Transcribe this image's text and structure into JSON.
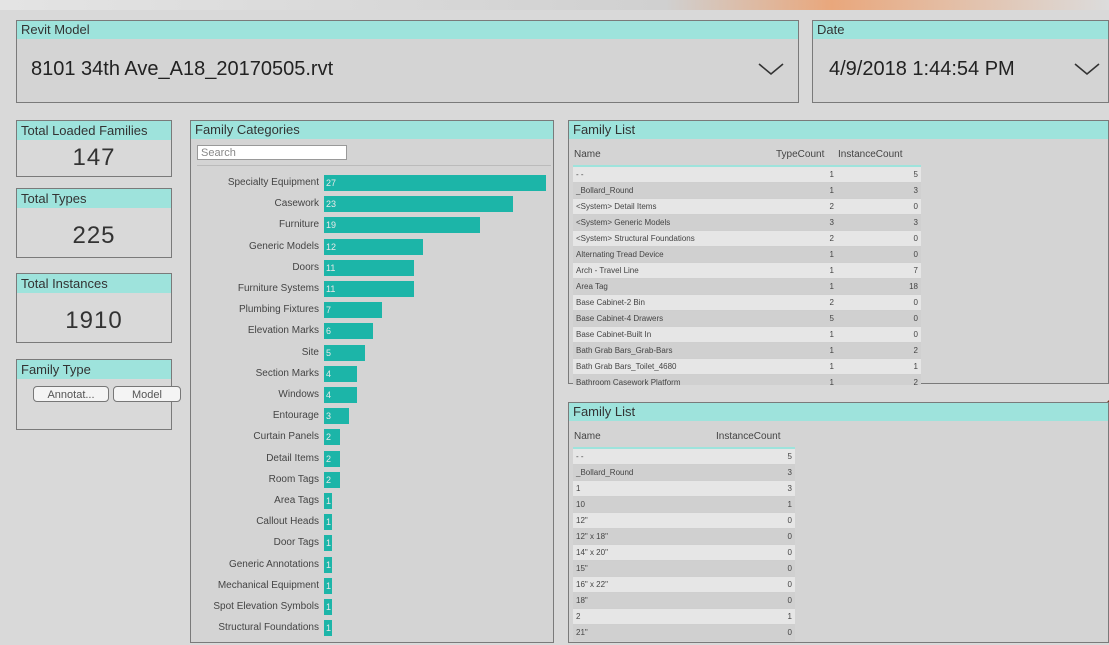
{
  "revit_model": {
    "label": "Revit Model",
    "value": "8101 34th Ave_A18_20170505.rvt"
  },
  "date": {
    "label": "Date",
    "value": "4/9/2018 1:44:54 PM"
  },
  "cards": {
    "loaded_families": {
      "label": "Total Loaded Families",
      "value": "147"
    },
    "types": {
      "label": "Total Types",
      "value": "225"
    },
    "instances": {
      "label": "Total Instances",
      "value": "1910"
    }
  },
  "family_type": {
    "label": "Family Type",
    "buttons": [
      "Annotat...",
      "Model"
    ]
  },
  "family_categories": {
    "title": "Family Categories",
    "search_placeholder": "Search"
  },
  "chart_data": {
    "type": "bar",
    "orientation": "horizontal",
    "categories": [
      "Specialty Equipment",
      "Casework",
      "Furniture",
      "Generic Models",
      "Doors",
      "Furniture Systems",
      "Plumbing Fixtures",
      "Elevation Marks",
      "Site",
      "Section Marks",
      "Windows",
      "Entourage",
      "Curtain Panels",
      "Detail Items",
      "Room Tags",
      "Area Tags",
      "Callout Heads",
      "Door Tags",
      "Generic Annotations",
      "Mechanical Equipment",
      "Spot Elevation Symbols",
      "Structural Foundations"
    ],
    "values": [
      27,
      23,
      19,
      12,
      11,
      11,
      7,
      6,
      5,
      4,
      4,
      3,
      2,
      2,
      2,
      1,
      1,
      1,
      1,
      1,
      1,
      1
    ],
    "labels": [
      "27",
      "23",
      "19",
      "12",
      "11",
      "11",
      "7",
      "6",
      "5",
      "4",
      "4",
      "3",
      "2",
      "2",
      "2",
      "1",
      "1",
      "1",
      "1",
      "1",
      "1",
      "1"
    ]
  },
  "family_list_1": {
    "title": "Family List",
    "headers": [
      "Name",
      "TypeCount",
      "InstanceCount"
    ],
    "rows": [
      [
        "- -",
        "1",
        "5"
      ],
      [
        "_Bollard_Round",
        "1",
        "3"
      ],
      [
        "<System> Detail Items",
        "2",
        "0"
      ],
      [
        "<System> Generic Models",
        "3",
        "3"
      ],
      [
        "<System> Structural Foundations",
        "2",
        "0"
      ],
      [
        "Alternating Tread Device",
        "1",
        "0"
      ],
      [
        "Arch - Travel Line",
        "1",
        "7"
      ],
      [
        "Area Tag",
        "1",
        "18"
      ],
      [
        "Base Cabinet-2 Bin",
        "2",
        "0"
      ],
      [
        "Base Cabinet-4 Drawers",
        "5",
        "0"
      ],
      [
        "Base Cabinet-Built In",
        "1",
        "0"
      ],
      [
        "Bath Grab Bars_Grab-Bars",
        "1",
        "2"
      ],
      [
        "Bath Grab Bars_Toilet_4680",
        "1",
        "1"
      ],
      [
        "Bathroom Casework Platform",
        "1",
        "2"
      ]
    ]
  },
  "family_list_2": {
    "title": "Family List",
    "headers": [
      "Name",
      "InstanceCount"
    ],
    "rows": [
      [
        "- -",
        "5"
      ],
      [
        "_Bollard_Round",
        "3"
      ],
      [
        "1",
        "3"
      ],
      [
        "10",
        "1"
      ],
      [
        "12\"",
        "0"
      ],
      [
        "12\" x 18\"",
        "0"
      ],
      [
        "14\" x 20\"",
        "0"
      ],
      [
        "15\"",
        "0"
      ],
      [
        "16\" x 22\"",
        "0"
      ],
      [
        "18\"",
        "0"
      ],
      [
        "2",
        "1"
      ],
      [
        "21\"",
        "0"
      ]
    ]
  },
  "colors": {
    "accent": "#1cb5a8",
    "header": "#9ee3dc",
    "triangle": "#7a3b1d"
  }
}
